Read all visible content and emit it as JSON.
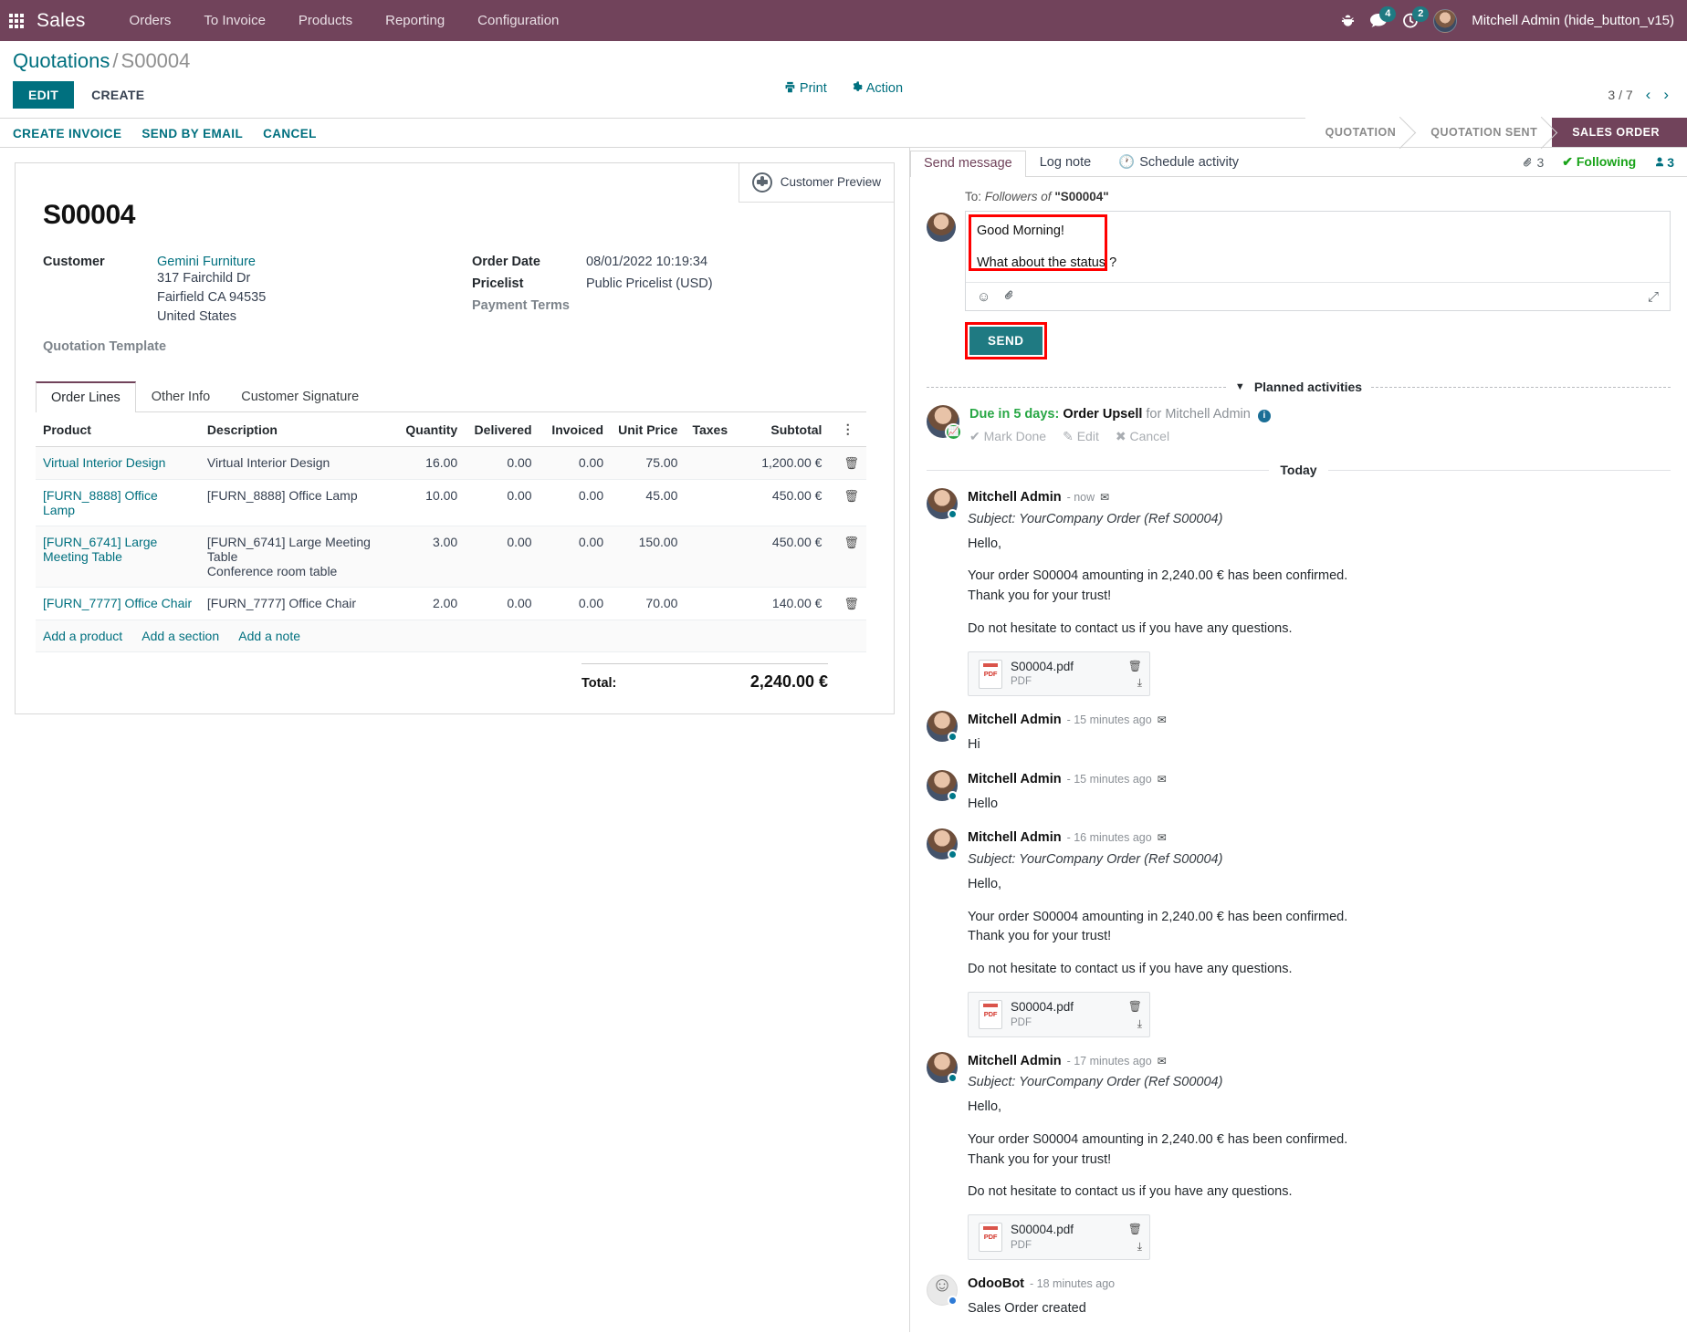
{
  "navbar": {
    "brand": "Sales",
    "menu": [
      "Orders",
      "To Invoice",
      "Products",
      "Reporting",
      "Configuration"
    ],
    "bug_icon": "bug-icon",
    "messages_badge": "4",
    "activities_badge": "2",
    "user": "Mitchell Admin (hide_button_v15)"
  },
  "control_panel": {
    "breadcrumb_root": "Quotations",
    "breadcrumb_sep": "/",
    "breadcrumb_current": "S00004",
    "edit_label": "EDIT",
    "create_label": "CREATE",
    "print_label": "Print",
    "action_label": "Action",
    "pager": "3 / 7"
  },
  "action_buttons": [
    "CREATE INVOICE",
    "SEND BY EMAIL",
    "CANCEL"
  ],
  "statusbar": {
    "stages": [
      "QUOTATION",
      "QUOTATION SENT",
      "SALES ORDER"
    ],
    "active": "SALES ORDER"
  },
  "form": {
    "stat_button": "Customer Preview",
    "title": "S00004",
    "customer_label": "Customer",
    "customer_name": "Gemini Furniture",
    "customer_addr1": "317 Fairchild Dr",
    "customer_addr2": "Fairfield CA 94535",
    "customer_country": "United States",
    "quotation_template_label": "Quotation Template",
    "order_date_label": "Order Date",
    "order_date_value": "08/01/2022 10:19:34",
    "pricelist_label": "Pricelist",
    "pricelist_value": "Public Pricelist (USD)",
    "payment_terms_label": "Payment Terms"
  },
  "notebook": {
    "tabs": [
      "Order Lines",
      "Other Info",
      "Customer Signature"
    ],
    "active_tab": "Order Lines"
  },
  "table": {
    "headers": [
      "Product",
      "Description",
      "Quantity",
      "Delivered",
      "Invoiced",
      "Unit Price",
      "Taxes",
      "Subtotal"
    ],
    "rows": [
      {
        "product": "Virtual Interior Design",
        "description": "Virtual Interior Design",
        "description2": "",
        "quantity": "16.00",
        "delivered": "0.00",
        "invoiced": "0.00",
        "unit_price": "75.00",
        "taxes": "",
        "subtotal": "1,200.00 €"
      },
      {
        "product": "[FURN_8888] Office Lamp",
        "description": "[FURN_8888] Office Lamp",
        "description2": "",
        "quantity": "10.00",
        "delivered": "0.00",
        "invoiced": "0.00",
        "unit_price": "45.00",
        "taxes": "",
        "subtotal": "450.00 €"
      },
      {
        "product": "[FURN_6741] Large Meeting Table",
        "description": "[FURN_6741] Large Meeting Table",
        "description2": "Conference room table",
        "quantity": "3.00",
        "delivered": "0.00",
        "invoiced": "0.00",
        "unit_price": "150.00",
        "taxes": "",
        "subtotal": "450.00 €"
      },
      {
        "product": "[FURN_7777] Office Chair",
        "description": "[FURN_7777] Office Chair",
        "description2": "",
        "quantity": "2.00",
        "delivered": "0.00",
        "invoiced": "0.00",
        "unit_price": "70.00",
        "taxes": "",
        "subtotal": "140.00 €"
      }
    ],
    "add_links": [
      "Add a product",
      "Add a section",
      "Add a note"
    ],
    "total_label": "Total:",
    "total_value": "2,240.00 €"
  },
  "chatter": {
    "tabs": [
      "Send message",
      "Log note",
      "Schedule activity"
    ],
    "active_tab": "Send message",
    "attachment_count": "3",
    "following_label": "Following",
    "followers_count": "3",
    "to_prefix": "To:",
    "to_followers": "Followers of",
    "to_record": "\"S00004\"",
    "composer_line1": "Good Morning!",
    "composer_line2": "What about the status ?",
    "send_label": "SEND",
    "planned_activities_label": "Planned activities",
    "today_label": "Today",
    "activity": {
      "due": "Due in 5 days:",
      "name": "Order Upsell",
      "for": "for Mitchell Admin",
      "mark_done": "Mark Done",
      "edit": "Edit",
      "cancel": "Cancel"
    },
    "messages": [
      {
        "author": "Mitchell Admin",
        "time": "- now",
        "subject": "Subject: YourCompany Order (Ref S00004)",
        "greeting": "Hello,",
        "body1": "Your order S00004 amounting in 2,240.00 € has been confirmed.",
        "body2": "Thank you for your trust!",
        "body3": "Do not hesitate to contact us if you have any questions.",
        "attachment_name": "S00004.pdf",
        "attachment_type": "PDF",
        "short": ""
      },
      {
        "author": "Mitchell Admin",
        "time": "- 15 minutes ago",
        "subject": "",
        "short": "Hi"
      },
      {
        "author": "Mitchell Admin",
        "time": "- 15 minutes ago",
        "subject": "",
        "short": "Hello"
      },
      {
        "author": "Mitchell Admin",
        "time": "- 16 minutes ago",
        "subject": "Subject: YourCompany Order (Ref S00004)",
        "greeting": "Hello,",
        "body1": "Your order S00004 amounting in 2,240.00 € has been confirmed.",
        "body2": "Thank you for your trust!",
        "body3": "Do not hesitate to contact us if you have any questions.",
        "attachment_name": "S00004.pdf",
        "attachment_type": "PDF",
        "short": ""
      },
      {
        "author": "Mitchell Admin",
        "time": "- 17 minutes ago",
        "subject": "Subject: YourCompany Order (Ref S00004)",
        "greeting": "Hello,",
        "body1": "Your order S00004 amounting in 2,240.00 € has been confirmed.",
        "body2": "Thank you for your trust!",
        "body3": "Do not hesitate to contact us if you have any questions.",
        "attachment_name": "S00004.pdf",
        "attachment_type": "PDF",
        "short": ""
      },
      {
        "author": "OdooBot",
        "time": "- 18 minutes ago",
        "subject": "",
        "short": "Sales Order created"
      }
    ]
  },
  "colors": {
    "navbar": "#71435b",
    "primary": "#00707f",
    "send_button": "#1f7a82",
    "highlight": "#ff0000",
    "activity_green": "#28a745"
  }
}
